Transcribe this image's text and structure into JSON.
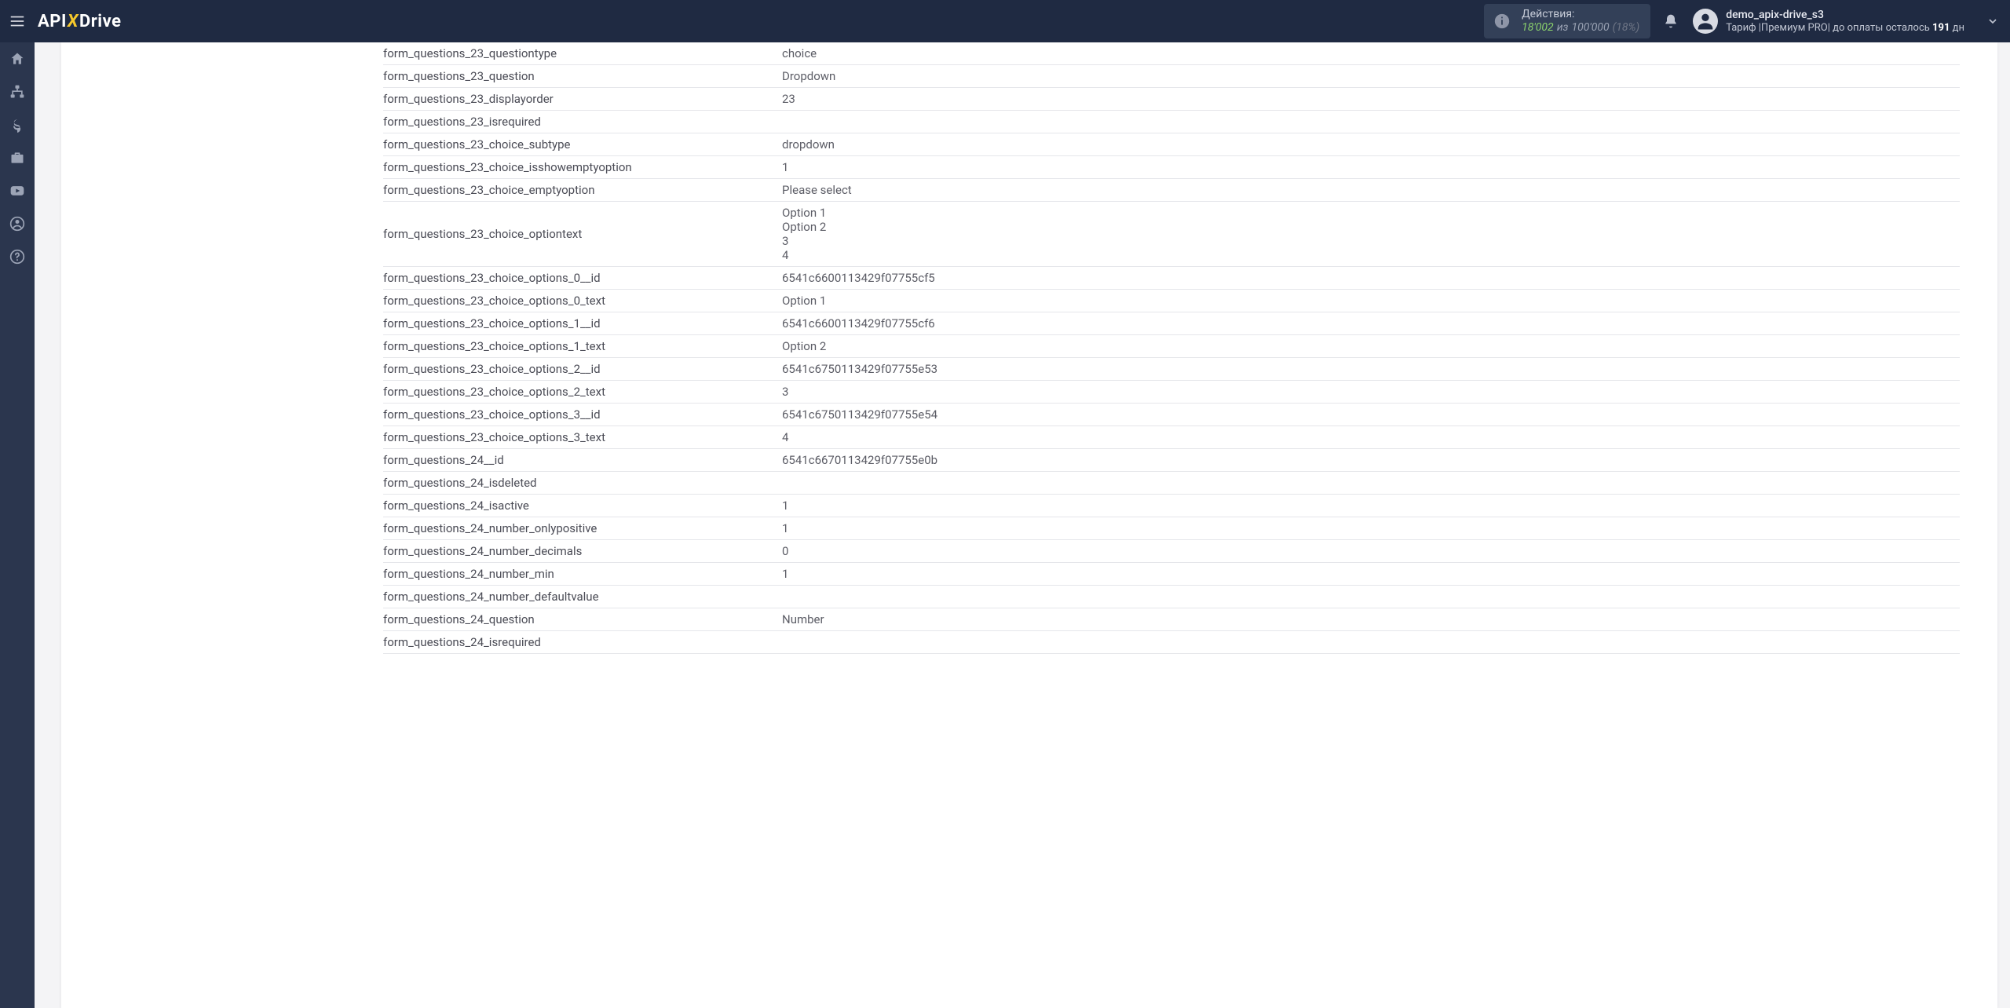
{
  "header": {
    "logo": {
      "api": "API",
      "x": "X",
      "drive": "Drive"
    },
    "actions": {
      "label": "Действия:",
      "used": "18'002",
      "iz": "из",
      "limit": "100'000",
      "pct": "(18%)"
    },
    "user": {
      "name": "demo_apix-drive_s3",
      "tariff_prefix": "Тариф |Премиум PRO| до оплаты осталось ",
      "days": "191",
      "tariff_suffix": " дн"
    }
  },
  "rows": [
    {
      "k": "form_questions_23_questiontype",
      "v": "choice"
    },
    {
      "k": "form_questions_23_question",
      "v": "Dropdown"
    },
    {
      "k": "form_questions_23_displayorder",
      "v": "23"
    },
    {
      "k": "form_questions_23_isrequired",
      "v": ""
    },
    {
      "k": "form_questions_23_choice_subtype",
      "v": "dropdown"
    },
    {
      "k": "form_questions_23_choice_isshowemptyoption",
      "v": "1"
    },
    {
      "k": "form_questions_23_choice_emptyoption",
      "v": "Please select"
    },
    {
      "k": "form_questions_23_choice_optiontext",
      "v": "Option 1\nOption 2\n3\n4"
    },
    {
      "k": "form_questions_23_choice_options_0__id",
      "v": "6541c6600113429f07755cf5"
    },
    {
      "k": "form_questions_23_choice_options_0_text",
      "v": "Option 1"
    },
    {
      "k": "form_questions_23_choice_options_1__id",
      "v": "6541c6600113429f07755cf6"
    },
    {
      "k": "form_questions_23_choice_options_1_text",
      "v": "Option 2"
    },
    {
      "k": "form_questions_23_choice_options_2__id",
      "v": "6541c6750113429f07755e53"
    },
    {
      "k": "form_questions_23_choice_options_2_text",
      "v": "3"
    },
    {
      "k": "form_questions_23_choice_options_3__id",
      "v": "6541c6750113429f07755e54"
    },
    {
      "k": "form_questions_23_choice_options_3_text",
      "v": "4"
    },
    {
      "k": "form_questions_24__id",
      "v": "6541c6670113429f07755e0b"
    },
    {
      "k": "form_questions_24_isdeleted",
      "v": ""
    },
    {
      "k": "form_questions_24_isactive",
      "v": "1"
    },
    {
      "k": "form_questions_24_number_onlypositive",
      "v": "1"
    },
    {
      "k": "form_questions_24_number_decimals",
      "v": "0"
    },
    {
      "k": "form_questions_24_number_min",
      "v": "1"
    },
    {
      "k": "form_questions_24_number_defaultvalue",
      "v": ""
    },
    {
      "k": "form_questions_24_question",
      "v": "Number"
    },
    {
      "k": "form_questions_24_isrequired",
      "v": ""
    }
  ]
}
